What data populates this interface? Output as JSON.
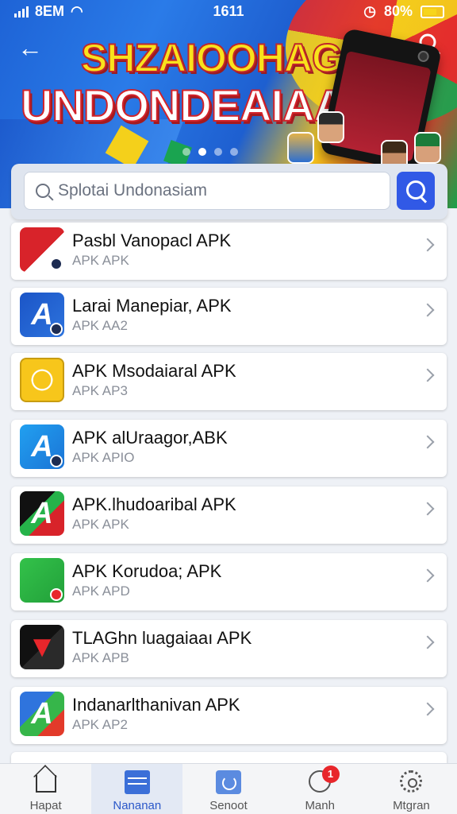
{
  "status_bar": {
    "carrier": "8ЕМ",
    "time": "1611",
    "battery": "80%"
  },
  "banner": {
    "title_line1": "SHZAIOOHAGA",
    "title_line2": "UNDONDEAIAA"
  },
  "search": {
    "placeholder": "Splotai Undonasiam"
  },
  "apps": [
    {
      "name": "Pasbl Vanopacl APK",
      "sub": "APK APK",
      "icon": "red-white-app-icon"
    },
    {
      "name": "Larai Manepiar, APK",
      "sub": "APK AA2",
      "icon": "blue-a-app-icon"
    },
    {
      "name": "APK Msodaiaral APK",
      "sub": "APK AP3",
      "icon": "yellow-emblem-app-icon"
    },
    {
      "name": "APK alUraagor,ABK",
      "sub": "APK APIO",
      "icon": "light-blue-a-app-icon"
    },
    {
      "name": "APK.lhudoaribal APK",
      "sub": "APK APK",
      "icon": "dark-multicolor-app-icon"
    },
    {
      "name": "APK Korudoa; APK",
      "sub": "APK APD",
      "icon": "green-app-icon"
    },
    {
      "name": "TLAGhn luagaiaaı APK",
      "sub": "APK APB",
      "icon": "black-colorful-app-icon"
    },
    {
      "name": "Indanarlthanivan APK",
      "sub": "APK AP2",
      "icon": "gradient-a-app-icon"
    }
  ],
  "tabs": [
    {
      "label": "Hapat",
      "icon": "home-icon"
    },
    {
      "label": "Nananan",
      "icon": "calendar-icon"
    },
    {
      "label": "Senoot",
      "icon": "refresh-icon"
    },
    {
      "label": "Manh",
      "icon": "chat-icon",
      "badge": "1"
    },
    {
      "label": "Mtgran",
      "icon": "gear-icon"
    }
  ],
  "colors": {
    "accent": "#3159e6",
    "badge": "#e8262b"
  }
}
